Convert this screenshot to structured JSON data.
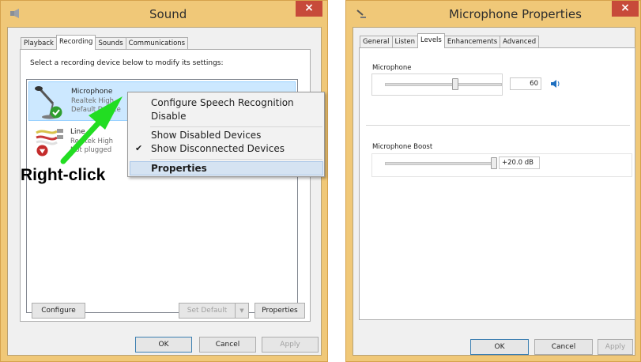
{
  "sound_window": {
    "title": "Sound",
    "close_glyph": "×",
    "tabs": [
      "Playback",
      "Recording",
      "Sounds",
      "Communications"
    ],
    "active_tab": "Recording",
    "instruction": "Select a recording device below to modify its settings:",
    "devices": [
      {
        "name": "Microphone",
        "line1": "Realtek High",
        "line2": "Default Device",
        "status_icon": "green-check-icon"
      },
      {
        "name": "Line",
        "line1": "Realtek High",
        "line2": "Not plugged",
        "status_icon": "red-down-arrow-icon"
      }
    ],
    "buttons": {
      "configure": "Configure",
      "set_default": "Set Default",
      "properties": "Properties",
      "ok": "OK",
      "cancel": "Cancel",
      "apply": "Apply"
    }
  },
  "context_menu": {
    "items": [
      {
        "label": "Configure Speech Recognition"
      },
      {
        "label": "Disable"
      },
      {
        "label": "Show Disabled Devices"
      },
      {
        "label": "Show Disconnected Devices",
        "checked": true
      },
      {
        "label": "Properties",
        "bold": true,
        "highlighted": true
      }
    ]
  },
  "annotation": {
    "text": "Right-click",
    "arrow_color": "#22dd22"
  },
  "mic_window": {
    "title": "Microphone Properties",
    "close_glyph": "×",
    "tabs": [
      "General",
      "Listen",
      "Levels",
      "Enhancements",
      "Advanced"
    ],
    "active_tab": "Levels",
    "microphone_group": {
      "label": "Microphone",
      "value": "60",
      "level_fraction": 0.6
    },
    "boost_group": {
      "label": "Microphone Boost",
      "value": "+20.0 dB",
      "level_fraction": 1.0
    },
    "buttons": {
      "ok": "OK",
      "cancel": "Cancel",
      "apply": "Apply"
    }
  },
  "colors": {
    "frame": "#f0c878",
    "close": "#c74a3a",
    "selection": "#cce8ff",
    "menu_highlight": "#d5e3f2"
  }
}
